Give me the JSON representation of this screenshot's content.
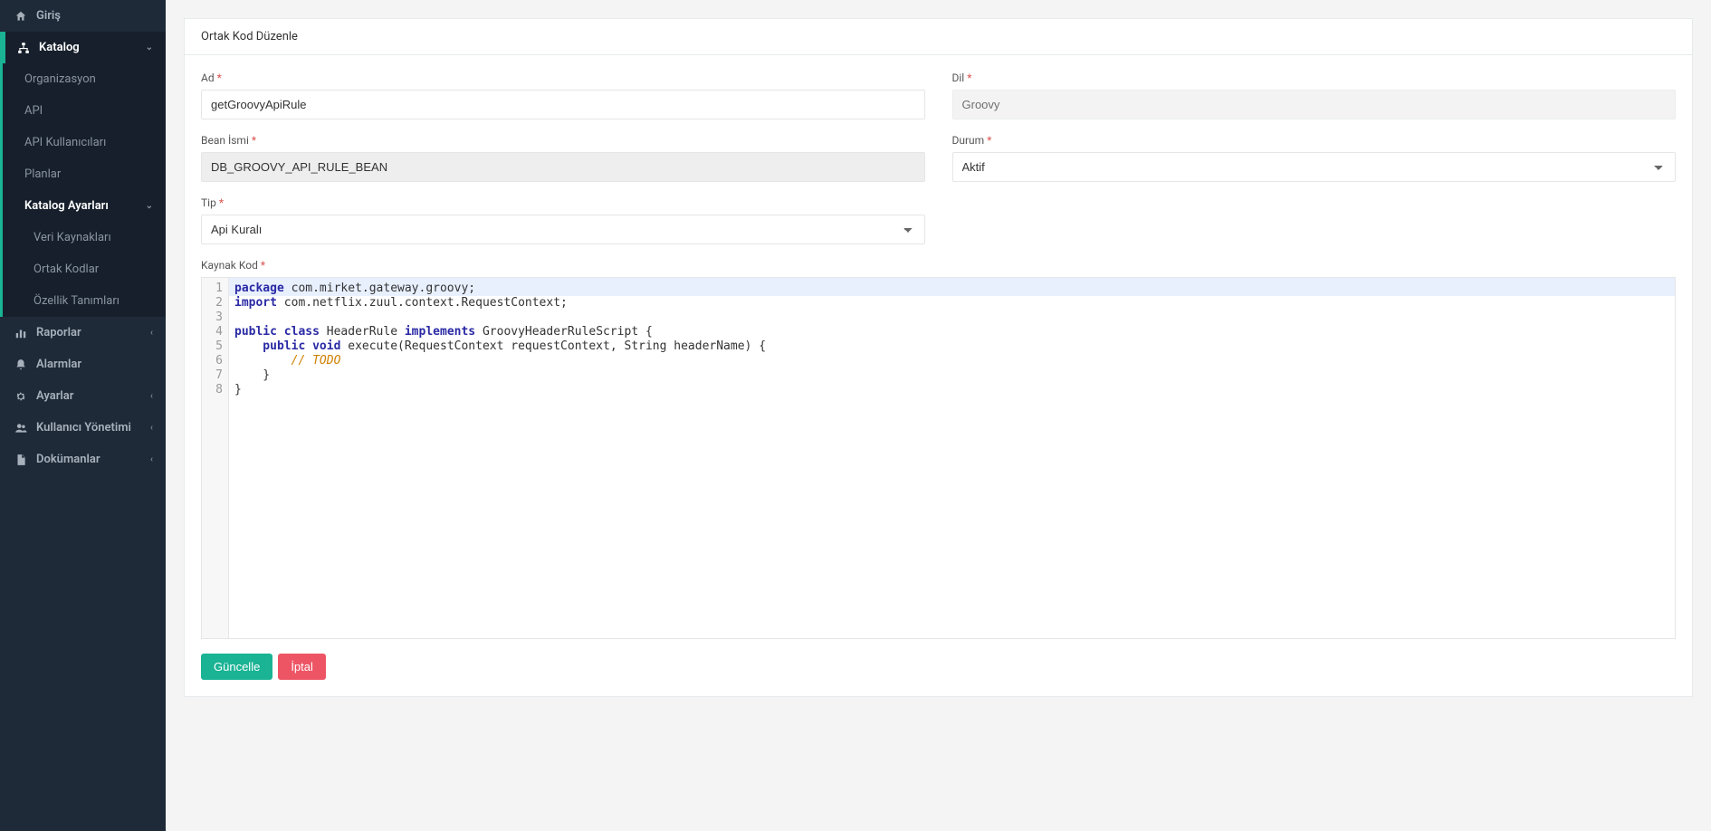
{
  "sidebar": {
    "home": "Giriş",
    "katalog": "Katalog",
    "submenu": {
      "org": "Organizasyon",
      "api": "API",
      "api_users": "API Kullanıcıları",
      "plans": "Planlar",
      "katalog_settings": "Katalog Ayarları",
      "data_sources": "Veri Kaynakları",
      "shared_codes": "Ortak Kodlar",
      "feature_defs": "Özellik Tanımları"
    },
    "reports": "Raporlar",
    "alarms": "Alarmlar",
    "settings": "Ayarlar",
    "user_mgmt": "Kullanıcı Yönetimi",
    "documents": "Dokümanlar"
  },
  "page": {
    "title": "Ortak Kod Düzenle"
  },
  "form": {
    "name_label": "Ad",
    "name_value": "getGroovyApiRule",
    "bean_label": "Bean İsmi",
    "bean_value": "DB_GROOVY_API_RULE_BEAN",
    "type_label": "Tip",
    "type_value": "Api Kuralı",
    "lang_label": "Dil",
    "lang_value": "Groovy",
    "status_label": "Durum",
    "status_value": "Aktif",
    "source_label": "Kaynak Kod"
  },
  "code": {
    "line1_kw": "package",
    "line1_rest": " com.mirket.gateway.groovy;",
    "line2_kw": "import",
    "line2_rest": " com.netflix.zuul.context.RequestContext;",
    "line4_a": "public",
    "line4_b": " class",
    "line4_c": " HeaderRule ",
    "line4_d": "implements",
    "line4_e": " GroovyHeaderRuleScript {",
    "line5_a": "    public",
    "line5_b": " void",
    "line5_c": " execute(RequestContext requestContext, String headerName) {",
    "line6": "        // TODO",
    "line7": "    }",
    "line8": "}"
  },
  "buttons": {
    "update": "Güncelle",
    "cancel": "İptal"
  }
}
